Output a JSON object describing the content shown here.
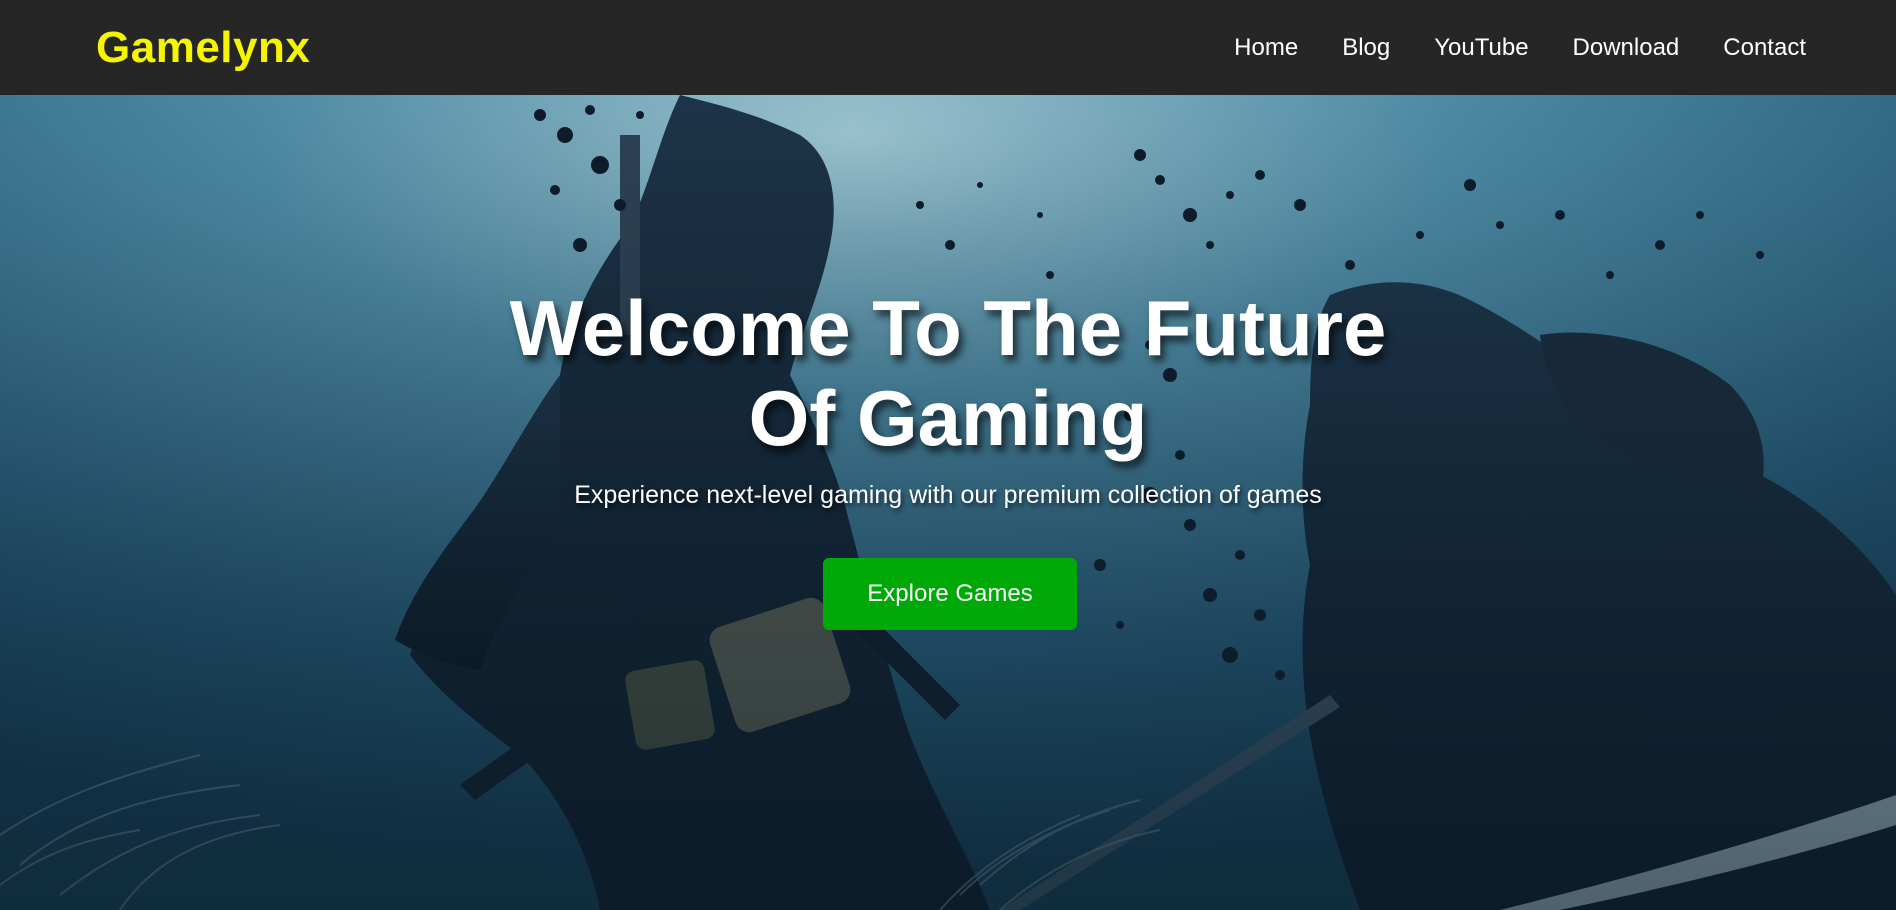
{
  "brand": {
    "name": "Gamelynx",
    "color": "#f5f500"
  },
  "nav": {
    "items": [
      {
        "label": "Home"
      },
      {
        "label": "Blog"
      },
      {
        "label": "YouTube"
      },
      {
        "label": "Download"
      },
      {
        "label": "Contact"
      }
    ]
  },
  "hero": {
    "title_line1": "Welcome To The Future",
    "title_line2": "Of Gaming",
    "subtitle": "Experience next-level gaming with our premium collection of games",
    "cta_label": "Explore Games",
    "cta_color": "#00a808",
    "background_scene": "samurai-duel-scene"
  },
  "colors": {
    "navbar_bg": "#262626",
    "text": "#ffffff",
    "hero_tint": "#1b3c52"
  }
}
